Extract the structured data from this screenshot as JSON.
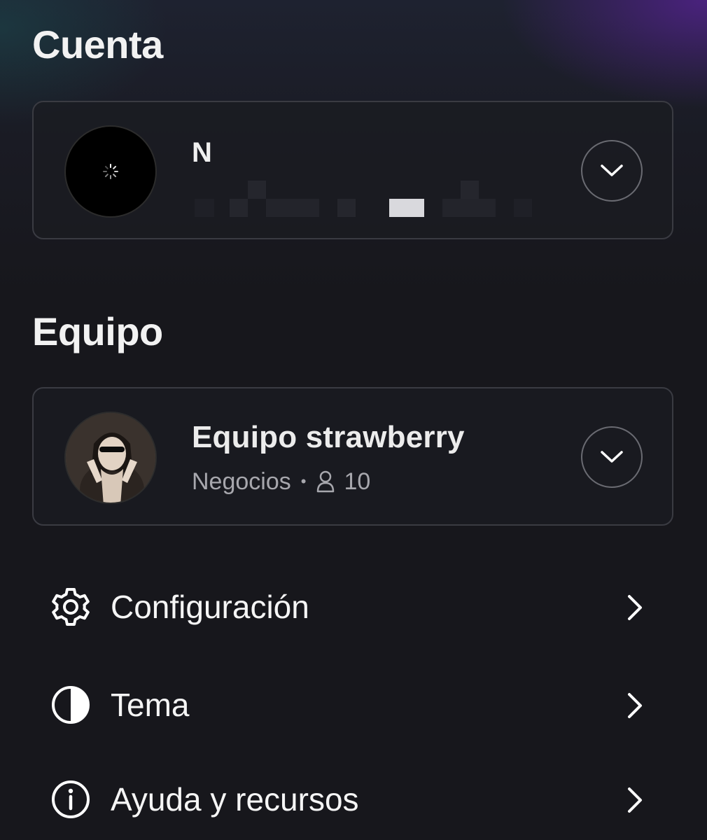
{
  "account": {
    "title": "Cuenta",
    "name": "N",
    "avatar_icon": "loading-spinner-icon",
    "expand_icon": "chevron-down-icon"
  },
  "team": {
    "title": "Equipo",
    "name": "Equipo strawberry",
    "plan": "Negocios",
    "separator": "•",
    "members_icon": "person-icon",
    "member_count": "10",
    "expand_icon": "chevron-down-icon"
  },
  "menu": [
    {
      "label": "Configuración",
      "icon": "gear-icon"
    },
    {
      "label": "Tema",
      "icon": "contrast-icon"
    },
    {
      "label": "Ayuda y recursos",
      "icon": "info-icon"
    }
  ],
  "colors": {
    "background": "#17171c",
    "card_border": "#3a3b42",
    "text_primary": "#ffffff",
    "text_secondary": "#a7a7ad",
    "gradient_accent": "#6e23be"
  }
}
